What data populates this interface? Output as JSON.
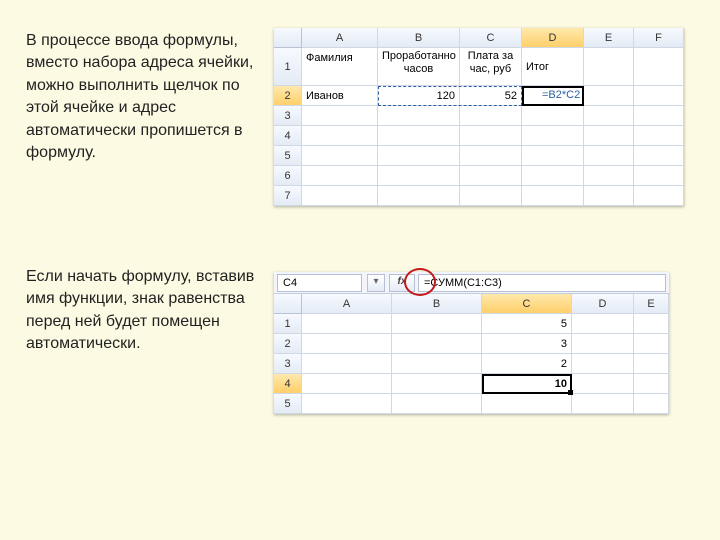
{
  "text1": "В процессе ввода формулы, вместо набора адреса ячейки, можно выполнить щелчок по этой ячейке и адрес автоматически пропишется в формулу.",
  "text2": "Если начать формулу, вставив имя функции, знак равенства перед ней будет помещен автоматически.",
  "ss1": {
    "cols": [
      "A",
      "B",
      "C",
      "D",
      "E",
      "F"
    ],
    "rows": [
      "1",
      "2",
      "3",
      "4",
      "5",
      "6",
      "7"
    ],
    "headers": {
      "A1": "Фамилия",
      "B1": "Проработанно часов",
      "C1": "Плата за час, руб",
      "D1": "Итог"
    },
    "data": {
      "A2": "Иванов",
      "B2": "120",
      "C2": "52"
    },
    "formula_cell": "D2",
    "formula_text": "=B2*C2",
    "selected_col": "D",
    "selected_row": "2"
  },
  "ss2": {
    "namebox": "C4",
    "fx_label": "fx",
    "formula": "=СУММ(C1:C3)",
    "cols": [
      "A",
      "B",
      "C",
      "D",
      "E"
    ],
    "rows": [
      "1",
      "2",
      "3",
      "4",
      "5"
    ],
    "data": {
      "C1": "5",
      "C2": "3",
      "C3": "2",
      "C4": "10"
    },
    "selected_col": "C",
    "selected_row": "4",
    "active_cell": "C4"
  }
}
